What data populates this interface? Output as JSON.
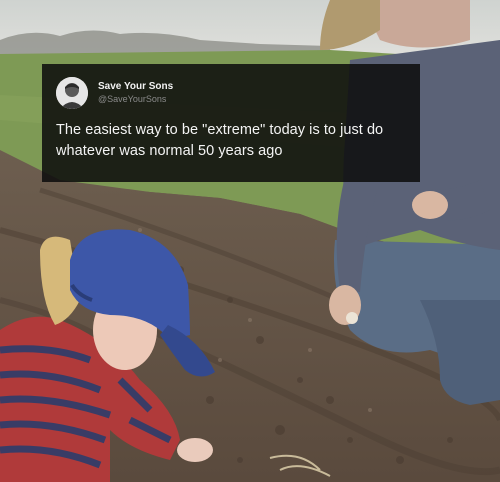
{
  "tweet": {
    "display_name": "Save Your Sons",
    "handle": "@SaveYourSons",
    "text": "The easiest way to be \"extreme\" today is to just do whatever was normal 50 years ago",
    "avatar": "profile-photo"
  },
  "photo": {
    "subject": "man and toddler planting in a tilled field",
    "colors": {
      "sky": "#d9dcd8",
      "soil": "#6b5a4b",
      "grass": "#7e9a55",
      "cap_man": "#b09a6f",
      "cap_child": "#3d57a8",
      "sweater_child": "#b03a3a",
      "hoodie_man": "#5b6277",
      "jeans_man": "#5a6d86"
    }
  }
}
